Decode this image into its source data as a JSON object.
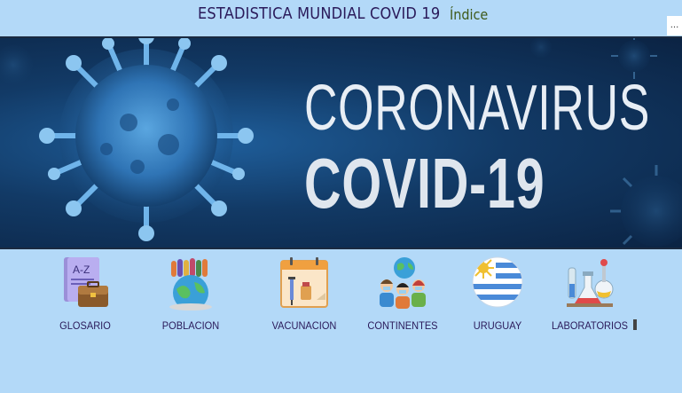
{
  "header": {
    "title": "ESTADISTICA MUNDIAL COVID 19",
    "index_link": "Índice",
    "more_label": "..."
  },
  "hero": {
    "line1": "CORONAVIRUS",
    "line2": "COVID-19"
  },
  "nav": {
    "items": [
      {
        "label": "GLOSARIO",
        "icon": "glossary-icon"
      },
      {
        "label": "POBLACION",
        "icon": "population-icon"
      },
      {
        "label": "VACUNACION",
        "icon": "vaccine-calendar-icon"
      },
      {
        "label": "CONTINENTES",
        "icon": "people-globe-icon"
      },
      {
        "label": "URUGUAY",
        "icon": "uruguay-flag-icon"
      },
      {
        "label": "LABORATORIOS",
        "icon": "laboratory-icon"
      }
    ]
  },
  "colors": {
    "background": "#b3d9f8",
    "title_text": "#2a1a5a",
    "link_text": "#3f5a1a",
    "hero_dark": "#0b2343"
  }
}
